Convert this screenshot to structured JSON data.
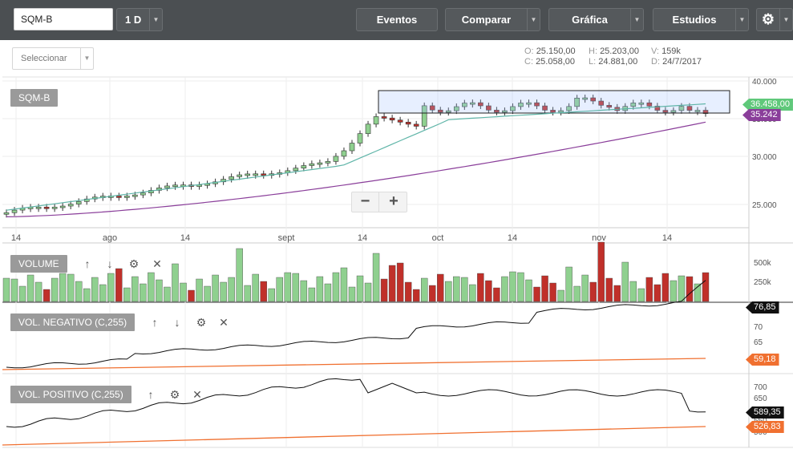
{
  "toolbar": {
    "symbol": "SQM-B",
    "interval": "1 D",
    "events_label": "Eventos",
    "compare_label": "Comparar",
    "chart_label": "Gráfica",
    "studies_label": "Estudios"
  },
  "subbar": {
    "select_label": "Seleccionar",
    "ohlc": {
      "o": "25.150,00",
      "h": "25.203,00",
      "v": "159k",
      "c": "25.058,00",
      "l": "24.881,00",
      "d": "24/7/2017"
    },
    "keys": {
      "o": "O:",
      "h": "H:",
      "v": "V:",
      "c": "C:",
      "l": "L:",
      "d": "D:"
    }
  },
  "main": {
    "label": "SQM-B",
    "price_ticks": [
      "40.000",
      "35.000",
      "30.000",
      "25.000"
    ],
    "date_ticks": [
      "14",
      "ago",
      "14",
      "sept",
      "14",
      "oct",
      "14",
      "nov",
      "14"
    ],
    "last_price": "36.458,00",
    "ma_price": "35.242",
    "zoom_out": "−",
    "zoom_in": "+"
  },
  "volume": {
    "label": "VOLUME",
    "ticks": [
      "500k",
      "250k"
    ]
  },
  "volneg": {
    "label": "VOL. NEGATIVO (C,255)",
    "ticks": [
      "70",
      "65"
    ],
    "value": "76,85",
    "value2": "59,18"
  },
  "volpos": {
    "label": "VOL. POSITIVO (C,255)",
    "ticks": [
      "700",
      "650",
      "600",
      "550",
      "500"
    ],
    "value": "589,35",
    "value2": "526,83"
  },
  "colors": {
    "up": "#8fd08f",
    "down": "#c0302a",
    "ma_fast": "#5fb5a8",
    "ma_slow": "#8a3e9a",
    "orange": "#f07030"
  }
}
